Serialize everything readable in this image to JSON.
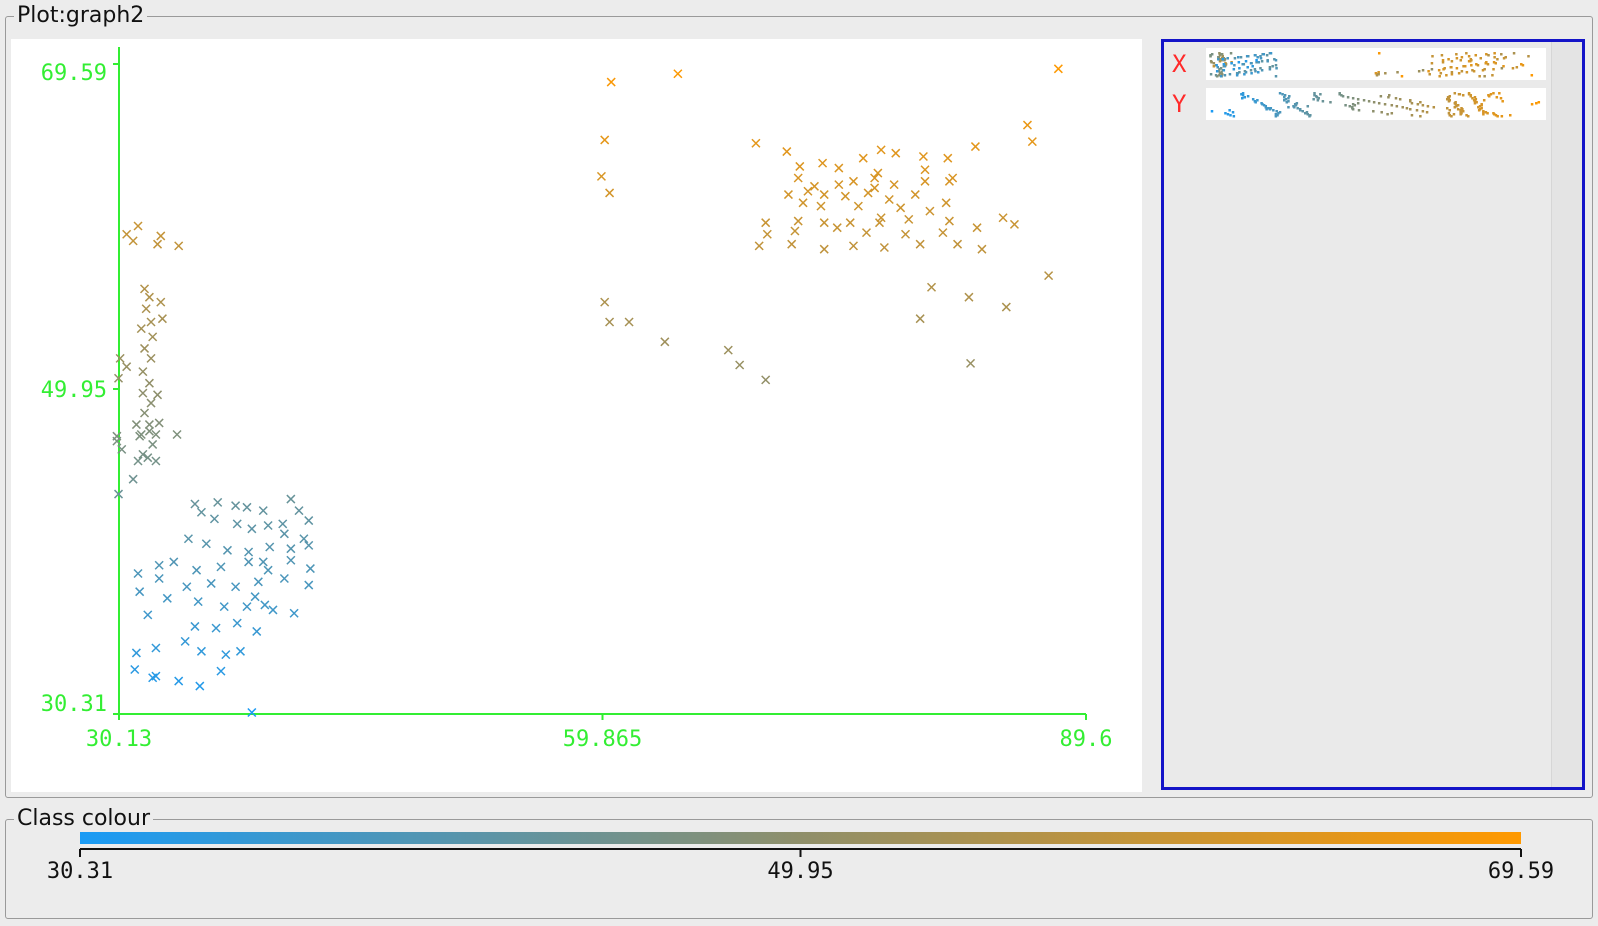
{
  "plot_panel": {
    "title": "Plot:graph2"
  },
  "class_panel": {
    "title": "Class colour"
  },
  "attribute_panel": {
    "rows": [
      {
        "name": "X"
      },
      {
        "name": "Y"
      }
    ]
  },
  "colors": {
    "axis": "#33ee33",
    "low": "#1a9bf5",
    "mid": "#8f8f6a",
    "high": "#ff9900",
    "selection_border": "#1414c8",
    "attr_name": "#ff2a2a"
  },
  "colour_scale": {
    "min": 30.31,
    "max": 69.59,
    "ticks": [
      "30.31",
      "49.95",
      "69.59"
    ]
  },
  "chart_data": {
    "type": "scatter",
    "marker": "x",
    "xlim": [
      30.13,
      89.6
    ],
    "ylim": [
      30.31,
      69.59
    ],
    "x_ticks": [
      "30.13",
      "59.865",
      "89.6"
    ],
    "y_ticks": [
      "30.31",
      "49.95",
      "69.59"
    ],
    "color_by": "y",
    "points": [
      [
        60.4,
        68.5
      ],
      [
        64.5,
        69.0
      ],
      [
        87.9,
        69.3
      ],
      [
        60.0,
        65.0
      ],
      [
        59.8,
        62.8
      ],
      [
        60.3,
        61.8
      ],
      [
        69.3,
        64.8
      ],
      [
        71.2,
        64.3
      ],
      [
        72.0,
        63.4
      ],
      [
        74.4,
        63.3
      ],
      [
        73.4,
        63.6
      ],
      [
        75.9,
        63.9
      ],
      [
        77.0,
        64.4
      ],
      [
        77.9,
        64.2
      ],
      [
        79.6,
        64.0
      ],
      [
        81.1,
        63.9
      ],
      [
        76.8,
        63.0
      ],
      [
        71.9,
        62.7
      ],
      [
        72.9,
        62.2
      ],
      [
        74.4,
        62.3
      ],
      [
        75.3,
        62.5
      ],
      [
        76.6,
        62.1
      ],
      [
        77.8,
        62.3
      ],
      [
        79.7,
        62.5
      ],
      [
        81.2,
        62.5
      ],
      [
        71.3,
        61.7
      ],
      [
        72.5,
        61.9
      ],
      [
        73.5,
        61.7
      ],
      [
        74.8,
        61.6
      ],
      [
        76.2,
        61.8
      ],
      [
        77.5,
        61.4
      ],
      [
        79.1,
        61.7
      ],
      [
        81.0,
        61.2
      ],
      [
        72.2,
        61.2
      ],
      [
        73.3,
        61.0
      ],
      [
        75.6,
        61.0
      ],
      [
        78.2,
        60.9
      ],
      [
        80.0,
        60.7
      ],
      [
        69.9,
        60.0
      ],
      [
        71.9,
        60.1
      ],
      [
        73.5,
        60.0
      ],
      [
        75.1,
        60.0
      ],
      [
        76.9,
        60.0
      ],
      [
        78.7,
        60.2
      ],
      [
        81.2,
        60.1
      ],
      [
        70.0,
        59.3
      ],
      [
        71.7,
        59.5
      ],
      [
        74.3,
        59.7
      ],
      [
        76.1,
        59.4
      ],
      [
        78.5,
        59.3
      ],
      [
        80.8,
        59.4
      ],
      [
        69.5,
        58.6
      ],
      [
        71.5,
        58.7
      ],
      [
        73.5,
        58.4
      ],
      [
        75.3,
        58.6
      ],
      [
        77.2,
        58.5
      ],
      [
        79.4,
        58.7
      ],
      [
        84.5,
        60.3
      ],
      [
        85.2,
        59.9
      ],
      [
        82.8,
        64.6
      ],
      [
        86.3,
        64.9
      ],
      [
        86.0,
        65.9
      ],
      [
        81.4,
        62.7
      ],
      [
        79.7,
        63.2
      ],
      [
        76.6,
        62.7
      ],
      [
        77.0,
        60.3
      ],
      [
        81.7,
        58.7
      ],
      [
        82.9,
        59.7
      ],
      [
        83.2,
        58.4
      ],
      [
        87.3,
        56.8
      ],
      [
        80.1,
        56.1
      ],
      [
        82.4,
        55.5
      ],
      [
        84.7,
        54.9
      ],
      [
        79.4,
        54.2
      ],
      [
        60.0,
        55.2
      ],
      [
        60.3,
        54.0
      ],
      [
        61.5,
        54.0
      ],
      [
        63.7,
        52.8
      ],
      [
        67.6,
        52.3
      ],
      [
        68.3,
        51.4
      ],
      [
        69.9,
        50.5
      ],
      [
        82.5,
        51.5
      ],
      [
        31.3,
        59.8
      ],
      [
        30.6,
        59.3
      ],
      [
        31.0,
        58.9
      ],
      [
        32.5,
        58.7
      ],
      [
        32.7,
        59.2
      ],
      [
        33.8,
        58.6
      ],
      [
        31.7,
        56.0
      ],
      [
        32.0,
        55.5
      ],
      [
        31.8,
        54.8
      ],
      [
        32.1,
        54.0
      ],
      [
        31.5,
        53.6
      ],
      [
        32.2,
        53.1
      ],
      [
        31.7,
        52.4
      ],
      [
        32.1,
        51.8
      ],
      [
        31.6,
        51.0
      ],
      [
        32.0,
        50.3
      ],
      [
        31.6,
        49.7
      ],
      [
        32.1,
        49.1
      ],
      [
        31.7,
        48.5
      ],
      [
        32.0,
        47.8
      ],
      [
        31.5,
        47.2
      ],
      [
        32.2,
        46.6
      ],
      [
        31.6,
        46.0
      ],
      [
        31.9,
        45.8
      ],
      [
        31.3,
        45.6
      ],
      [
        32.4,
        45.6
      ],
      [
        32.7,
        55.2
      ],
      [
        32.8,
        54.2
      ],
      [
        30.6,
        51.3
      ],
      [
        30.2,
        51.8
      ],
      [
        30.1,
        50.6
      ],
      [
        32.5,
        49.6
      ],
      [
        32.6,
        47.9
      ],
      [
        32.4,
        47.2
      ],
      [
        31.4,
        47.1
      ],
      [
        30.0,
        47.1
      ],
      [
        30.0,
        46.8
      ],
      [
        30.3,
        46.3
      ],
      [
        33.7,
        47.2
      ],
      [
        31.2,
        47.8
      ],
      [
        31.0,
        44.5
      ],
      [
        30.1,
        43.6
      ],
      [
        34.8,
        43.0
      ],
      [
        35.2,
        42.5
      ],
      [
        36.2,
        43.1
      ],
      [
        37.3,
        42.9
      ],
      [
        38.0,
        42.8
      ],
      [
        39.0,
        42.6
      ],
      [
        40.7,
        43.3
      ],
      [
        41.2,
        42.6
      ],
      [
        41.8,
        42.0
      ],
      [
        36.0,
        42.1
      ],
      [
        37.4,
        41.8
      ],
      [
        38.3,
        41.5
      ],
      [
        39.3,
        41.7
      ],
      [
        40.3,
        41.2
      ],
      [
        41.5,
        40.9
      ],
      [
        34.4,
        40.9
      ],
      [
        35.5,
        40.6
      ],
      [
        36.8,
        40.2
      ],
      [
        38.1,
        40.1
      ],
      [
        39.4,
        40.4
      ],
      [
        40.7,
        40.3
      ],
      [
        41.8,
        40.5
      ],
      [
        32.6,
        39.3
      ],
      [
        33.5,
        39.5
      ],
      [
        34.9,
        39.0
      ],
      [
        36.4,
        39.2
      ],
      [
        38.1,
        39.5
      ],
      [
        39.3,
        39.0
      ],
      [
        40.7,
        39.6
      ],
      [
        41.9,
        39.1
      ],
      [
        31.3,
        38.8
      ],
      [
        32.6,
        38.5
      ],
      [
        34.3,
        38.0
      ],
      [
        35.8,
        38.2
      ],
      [
        37.3,
        38.0
      ],
      [
        38.7,
        38.3
      ],
      [
        40.3,
        38.5
      ],
      [
        41.8,
        38.1
      ],
      [
        31.4,
        37.7
      ],
      [
        33.1,
        37.3
      ],
      [
        35.0,
        37.1
      ],
      [
        36.6,
        36.8
      ],
      [
        38.0,
        36.8
      ],
      [
        39.6,
        36.6
      ],
      [
        40.9,
        36.4
      ],
      [
        31.9,
        36.3
      ],
      [
        34.8,
        35.6
      ],
      [
        36.1,
        35.5
      ],
      [
        37.4,
        35.8
      ],
      [
        38.6,
        35.3
      ],
      [
        31.2,
        34.0
      ],
      [
        32.4,
        34.3
      ],
      [
        34.2,
        34.7
      ],
      [
        35.2,
        34.1
      ],
      [
        36.7,
        33.9
      ],
      [
        37.6,
        34.1
      ],
      [
        31.1,
        33.0
      ],
      [
        32.4,
        32.6
      ],
      [
        33.8,
        32.3
      ],
      [
        35.1,
        32.0
      ],
      [
        36.4,
        32.9
      ],
      [
        38.3,
        30.4
      ],
      [
        32.2,
        32.5
      ],
      [
        39.1,
        36.9
      ],
      [
        38.5,
        37.4
      ],
      [
        39.0,
        39.5
      ],
      [
        40.2,
        41.8
      ],
      [
        32.0,
        47.4
      ]
    ]
  }
}
